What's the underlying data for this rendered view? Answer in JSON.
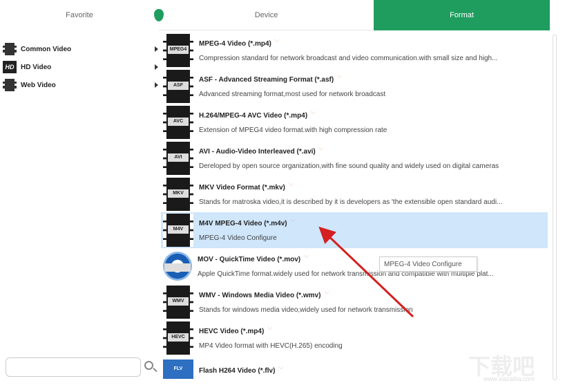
{
  "tabs": {
    "favorite": "Favorite",
    "device": "Device",
    "format": "Format"
  },
  "categories": [
    {
      "label": "Common Video",
      "icon": "film"
    },
    {
      "label": "HD Video",
      "icon": "hd",
      "badge": "HD"
    },
    {
      "label": "Web Video",
      "icon": "film"
    }
  ],
  "formats": [
    {
      "title": "MPEG-4 Video (*.mp4)",
      "desc": "Compression standard for network broadcast and video communication.with small size and high...",
      "badge": "MPEG4"
    },
    {
      "title": "ASF - Advanced Streaming Format (*.asf)",
      "desc": "Advanced streaming format,most used for network broadcast",
      "badge": "ASF"
    },
    {
      "title": "H.264/MPEG-4 AVC Video (*.mp4)",
      "desc": "Extension of MPEG4 video format.with high compression rate",
      "badge": "AVC"
    },
    {
      "title": "AVI - Audio-Video Interleaved (*.avi)",
      "desc": "Dereloped by open source organization,with fine sound quality and widely used on digital cameras",
      "badge": "AVI"
    },
    {
      "title": "MKV Video Format (*.mkv)",
      "desc": "Stands for matroska video,it is described by it is developers as 'the extensible open standard audi...",
      "badge": "MKV"
    },
    {
      "title": "M4V MPEG-4 Video (*.m4v)",
      "desc": "MPEG-4 Video Configure",
      "badge": "M4V",
      "selected": true
    },
    {
      "title": "MOV - QuickTime Video (*.mov)",
      "desc": "Apple QuickTime format.widely used for network transmission and compatible with multiple plat...",
      "badge": ""
    },
    {
      "title": "WMV - Windows Media Video (*.wmv)",
      "desc": "Stands for windows media video,widely used for network transmission",
      "badge": "WMV"
    },
    {
      "title": "HEVC Video (*.mp4)",
      "desc": "MP4 Video format with HEVC(H.265) encoding",
      "badge": "HEVC"
    },
    {
      "title": "Flash H264 Video (*.flv)",
      "desc": "",
      "badge": "FLV"
    }
  ],
  "heart_glyph": "♡",
  "tooltip": "MPEG-4 Video Configure",
  "search": {
    "value": "",
    "placeholder": ""
  },
  "watermark": "www.xiazaiba.com",
  "colors": {
    "accent": "#1f9d5f",
    "selected": "#cfe6fb",
    "annotation": "#d42020"
  }
}
